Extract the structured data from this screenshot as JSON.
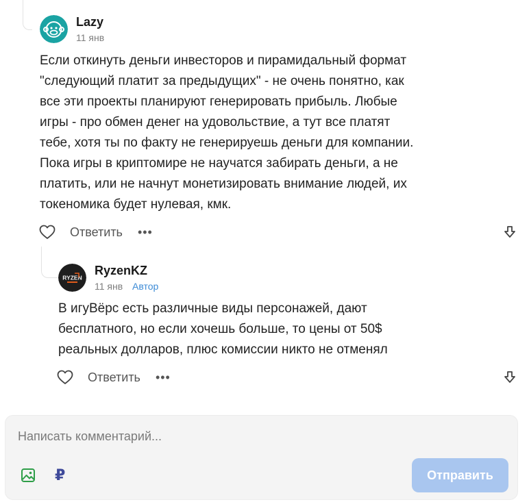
{
  "comment": {
    "author": "Lazy",
    "date": "11 янв",
    "lines": [
      "Если откинуть деньги инвесторов и пирамидальный формат",
      "\"следующий платит за предыдущих\" - не очень понятно, как",
      "все эти проекты планируют генерировать прибыль. Любые",
      "игры - про обмен денег на удовольствие, а тут все платят",
      "тебе, хотя ты по факту не генерируешь деньги для компании.",
      "Пока игры в криптомире не научатся забирать деньги, а не",
      "платить, или не начнут монетизировать внимание людей, их",
      "токеномика будет нулевая, кмк."
    ],
    "reply_label": "Ответить",
    "more_label": "•••",
    "avatar_icon": "monkey-avatar-icon",
    "avatar_color": "#1aa3a3"
  },
  "reply": {
    "author": "RyzenKZ",
    "date": "11 янв",
    "badge": "Автор",
    "avatar_text": "RYZEN",
    "lines": [
      "В игуВёрс есть различные виды персонажей, дают",
      "бесплатного, но если хочешь больше, то цены от 50$",
      "реальных долларов, плюс комиссии никто не отменял"
    ],
    "reply_label": "Ответить",
    "more_label": "•••"
  },
  "composer": {
    "placeholder": "Написать комментарий...",
    "ruble_symbol": "₽",
    "send_label": "Отправить",
    "send_color": "#a9c6ef"
  }
}
